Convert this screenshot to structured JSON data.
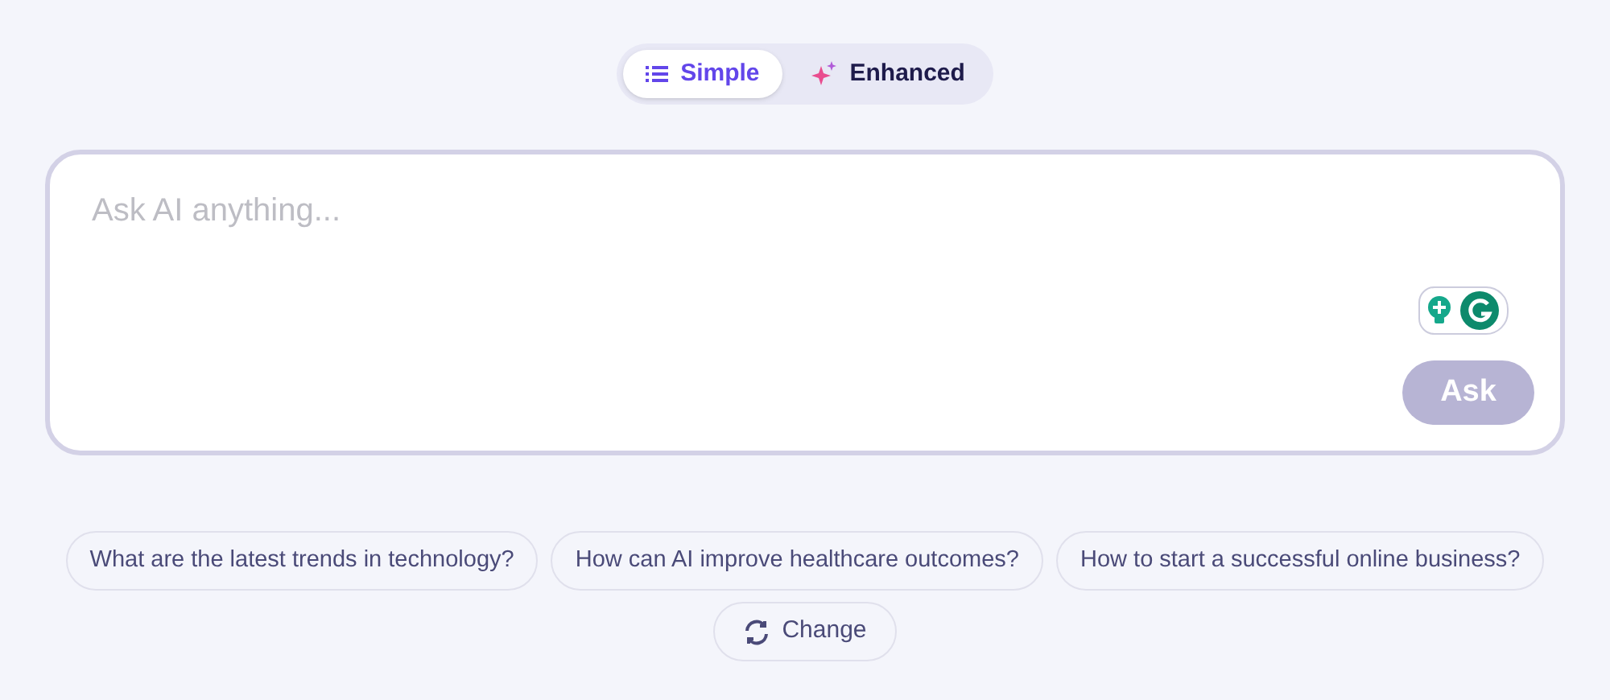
{
  "modes": [
    {
      "label": "Simple",
      "kind": "list",
      "selected": true
    },
    {
      "label": "Enhanced",
      "kind": "sparkle",
      "selected": false
    }
  ],
  "prompt": {
    "placeholder": "Ask AI anything...",
    "ask_button": {
      "label": "Ask",
      "disabled": true
    }
  },
  "suggestions": [
    "What are the latest trends in technology?",
    "How can AI improve healthcare outcomes?",
    "How to start a successful online business?"
  ],
  "change_button": "Change"
}
